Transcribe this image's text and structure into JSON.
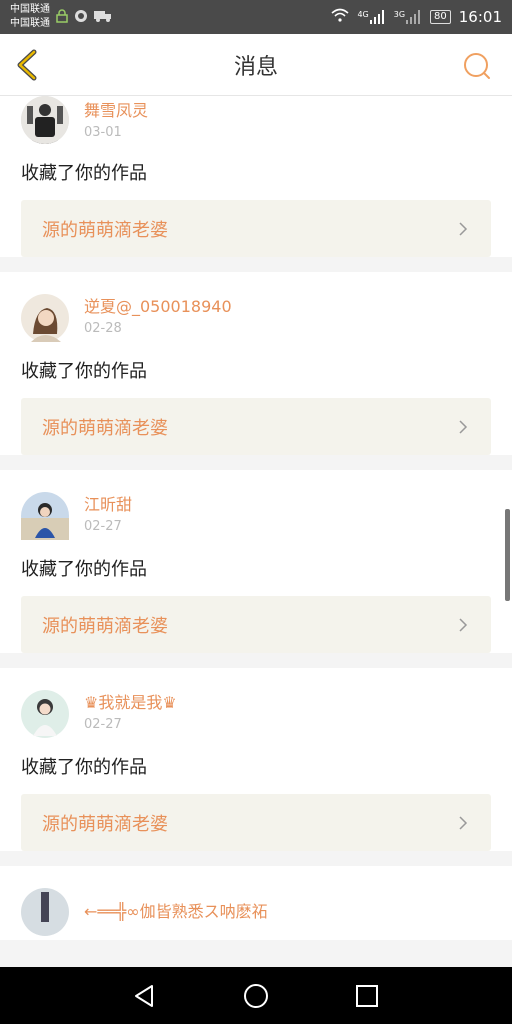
{
  "status_bar": {
    "carrier_1": "中国联通",
    "carrier_2": "中国联通",
    "net_1": "4G",
    "net_2": "3G",
    "battery": "80",
    "time": "16:01"
  },
  "nav": {
    "title": "消息",
    "back_icon": "chevron-left-icon",
    "search_icon": "search-icon",
    "accent_color": "#e8915a"
  },
  "notifications": [
    {
      "user": "舞雪凤灵",
      "date": "03-01",
      "action": "收藏了你的作品",
      "work": "源的萌萌滴老婆"
    },
    {
      "user": "逆夏@_050018940",
      "date": "02-28",
      "action": "收藏了你的作品",
      "work": "源的萌萌滴老婆"
    },
    {
      "user": "江昕甜",
      "date": "02-27",
      "action": "收藏了你的作品",
      "work": "源的萌萌滴老婆"
    },
    {
      "user": "♛我就是我♛",
      "date": "02-27",
      "action": "收藏了你的作品",
      "work": "源的萌萌滴老婆"
    },
    {
      "user": "←══╬∞伽皆熟悉ス呐麽祏",
      "date": "",
      "action": "",
      "work": ""
    }
  ],
  "system_nav": [
    "back-triangle-icon",
    "home-circle-icon",
    "recents-square-icon"
  ]
}
